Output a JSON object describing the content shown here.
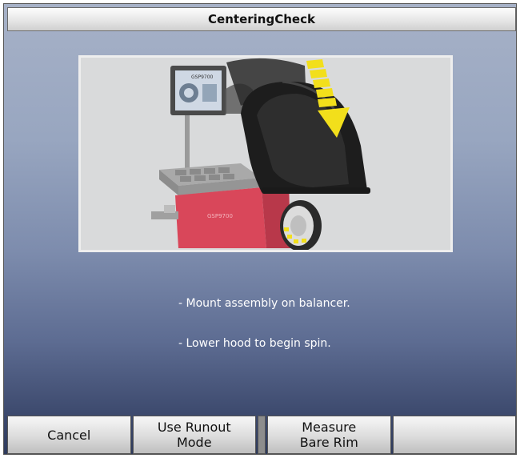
{
  "window": {
    "title": "CenteringCheck"
  },
  "illustration": {
    "monitor_text": "GSP9700",
    "cabinet_text": "GSP9700",
    "colors": {
      "cabinet": "#d9475a",
      "hood": "#1d1d1d",
      "arrow": "#f2df1b",
      "background": "#d9dadb"
    }
  },
  "instructions": [
    "- Mount assembly on balancer.",
    "- Lower hood to begin spin."
  ],
  "footer": {
    "buttons": [
      {
        "label_line1": "Cancel",
        "label_line2": ""
      },
      {
        "label_line1": "Use Runout",
        "label_line2": "Mode"
      },
      {
        "label_line1": "Measure",
        "label_line2": "Bare Rim"
      },
      {
        "label_line1": "",
        "label_line2": ""
      }
    ]
  }
}
